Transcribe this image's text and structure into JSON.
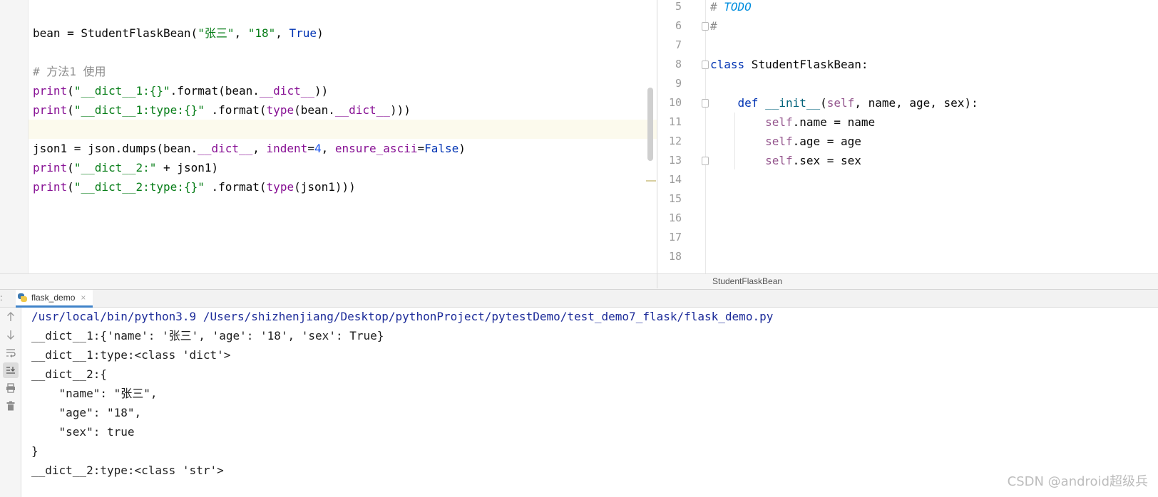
{
  "left_editor": {
    "lines": [
      {
        "tokens": [
          {
            "t": "bean = StudentFlaskBean(",
            "c": "plain"
          },
          {
            "t": "\"张三\"",
            "c": "str"
          },
          {
            "t": ", ",
            "c": "plain"
          },
          {
            "t": "\"18\"",
            "c": "str"
          },
          {
            "t": ", ",
            "c": "plain"
          },
          {
            "t": "True",
            "c": "kw"
          },
          {
            "t": ")",
            "c": "plain"
          }
        ]
      },
      {
        "tokens": []
      },
      {
        "tokens": [
          {
            "t": "# 方法1 使用",
            "c": "cm"
          }
        ]
      },
      {
        "tokens": [
          {
            "t": "print",
            "c": "mag"
          },
          {
            "t": "(",
            "c": "plain"
          },
          {
            "t": "\"__dict__1:{}\"",
            "c": "str"
          },
          {
            "t": ".format(bean.",
            "c": "plain"
          },
          {
            "t": "__dict__",
            "c": "mag"
          },
          {
            "t": "))",
            "c": "plain"
          }
        ]
      },
      {
        "tokens": [
          {
            "t": "print",
            "c": "mag"
          },
          {
            "t": "(",
            "c": "plain"
          },
          {
            "t": "\"__dict__1:type:{}\"",
            "c": "str"
          },
          {
            "t": " .format(",
            "c": "plain"
          },
          {
            "t": "type",
            "c": "mag"
          },
          {
            "t": "(bean.",
            "c": "plain"
          },
          {
            "t": "__dict__",
            "c": "mag"
          },
          {
            "t": ")))",
            "c": "plain"
          }
        ]
      },
      {
        "tokens": []
      },
      {
        "tokens": [
          {
            "t": "json1 = json.dumps(bean.",
            "c": "plain"
          },
          {
            "t": "__dict__",
            "c": "mag"
          },
          {
            "t": ", ",
            "c": "plain"
          },
          {
            "t": "indent",
            "c": "mag"
          },
          {
            "t": "=",
            "c": "plain"
          },
          {
            "t": "4",
            "c": "num"
          },
          {
            "t": ", ",
            "c": "plain"
          },
          {
            "t": "ensure_ascii",
            "c": "mag"
          },
          {
            "t": "=",
            "c": "plain"
          },
          {
            "t": "False",
            "c": "kw"
          },
          {
            "t": ")",
            "c": "plain"
          }
        ]
      },
      {
        "tokens": [
          {
            "t": "print",
            "c": "mag"
          },
          {
            "t": "(",
            "c": "plain"
          },
          {
            "t": "\"__dict__2:\"",
            "c": "str"
          },
          {
            "t": " + json1)",
            "c": "plain"
          }
        ]
      },
      {
        "tokens": [
          {
            "t": "print",
            "c": "mag"
          },
          {
            "t": "(",
            "c": "plain"
          },
          {
            "t": "\"__dict__2:type:{}\"",
            "c": "str"
          },
          {
            "t": " .format(",
            "c": "plain"
          },
          {
            "t": "type",
            "c": "mag"
          },
          {
            "t": "(json1)))",
            "c": "plain"
          }
        ]
      }
    ]
  },
  "right_editor": {
    "line_numbers": [
      "5",
      "6",
      "7",
      "8",
      "9",
      "10",
      "11",
      "12",
      "13",
      "14",
      "15",
      "16",
      "17",
      "18"
    ],
    "lines": [
      {
        "tokens": [
          {
            "t": "# ",
            "c": "cm"
          },
          {
            "t": "TODO",
            "c": "todo"
          }
        ]
      },
      {
        "tokens": [
          {
            "t": "#",
            "c": "cm"
          }
        ]
      },
      {
        "tokens": []
      },
      {
        "tokens": [
          {
            "t": "class",
            "c": "kw"
          },
          {
            "t": " StudentFlaskBean:",
            "c": "plain"
          }
        ]
      },
      {
        "tokens": []
      },
      {
        "tokens": [
          {
            "t": "    ",
            "c": "plain"
          },
          {
            "t": "def",
            "c": "kw"
          },
          {
            "t": " ",
            "c": "plain"
          },
          {
            "t": "__init__",
            "c": "fn"
          },
          {
            "t": "(",
            "c": "plain"
          },
          {
            "t": "self",
            "c": "self"
          },
          {
            "t": ", name, age, sex):",
            "c": "plain"
          }
        ]
      },
      {
        "tokens": [
          {
            "t": "        ",
            "c": "plain"
          },
          {
            "t": "self",
            "c": "self"
          },
          {
            "t": ".name = name",
            "c": "plain"
          }
        ]
      },
      {
        "tokens": [
          {
            "t": "        ",
            "c": "plain"
          },
          {
            "t": "self",
            "c": "self"
          },
          {
            "t": ".age = age",
            "c": "plain"
          }
        ]
      },
      {
        "tokens": [
          {
            "t": "        ",
            "c": "plain"
          },
          {
            "t": "self",
            "c": "self"
          },
          {
            "t": ".sex = sex",
            "c": "plain"
          }
        ]
      }
    ],
    "breadcrumb": "StudentFlaskBean"
  },
  "run_panel": {
    "tab_label": "flask_demo",
    "tab_prefix": ":",
    "close_glyph": "×",
    "toolbar_icons": [
      "arrow-up-icon",
      "arrow-down-icon",
      "soft-wrap-icon",
      "scroll-to-end-icon",
      "print-icon",
      "trash-icon"
    ],
    "output": [
      "/usr/local/bin/python3.9 /Users/shizhenjiang/Desktop/pythonProject/pytestDemo/test_demo7_flask/flask_demo.py",
      "__dict__1:{'name': '张三', 'age': '18', 'sex': True}",
      "__dict__1:type:<class 'dict'>",
      "__dict__2:{",
      "    \"name\": \"张三\",",
      "    \"age\": \"18\",",
      "    \"sex\": true",
      "}",
      "__dict__2:type:<class 'str'>"
    ]
  },
  "watermark": "CSDN @android超级兵"
}
